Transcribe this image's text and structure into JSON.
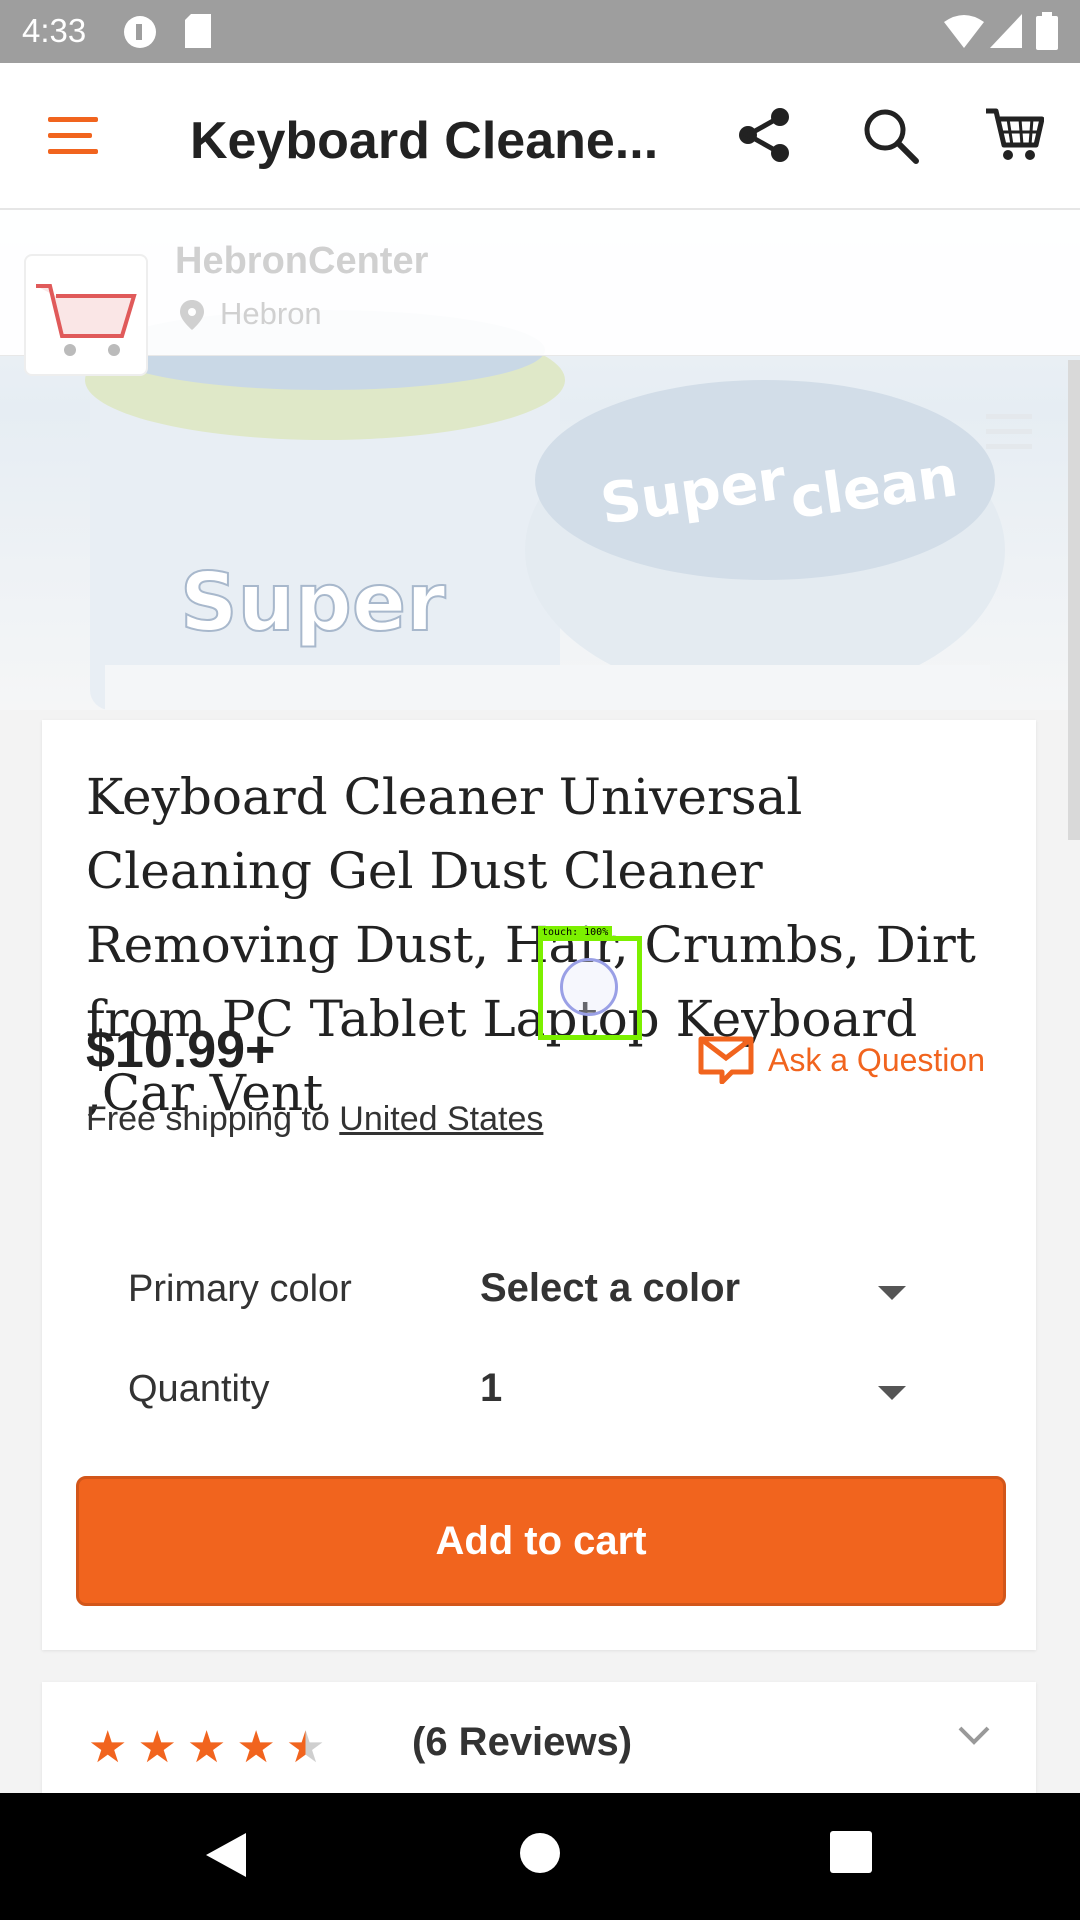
{
  "status_bar": {
    "time": "4:33"
  },
  "app_bar": {
    "title": "Keyboard Cleane..."
  },
  "shop": {
    "name": "HebronCenter",
    "location": "Hebron"
  },
  "product": {
    "title": "Keyboard Cleaner Universal Cleaning Gel Dust Cleaner Removing Dust, Hair, Crumbs, Dirt from PC Tablet Laptop Keyboard ,Car Vent",
    "price": "$10.99+",
    "ask_label": "Ask a Question",
    "shipping_prefix": "Free shipping to ",
    "shipping_country": "United States"
  },
  "options": [
    {
      "label": "Primary color",
      "value": "Select a color"
    },
    {
      "label": "Quantity",
      "value": "1"
    }
  ],
  "add_to_cart_label": "Add to cart",
  "reviews": {
    "rating": 4.5,
    "count_label": "(6 Reviews)"
  },
  "touch_indicator": {
    "label": "touch: 100%"
  },
  "colors": {
    "accent": "#f1641e",
    "touch": "#7cf000"
  }
}
